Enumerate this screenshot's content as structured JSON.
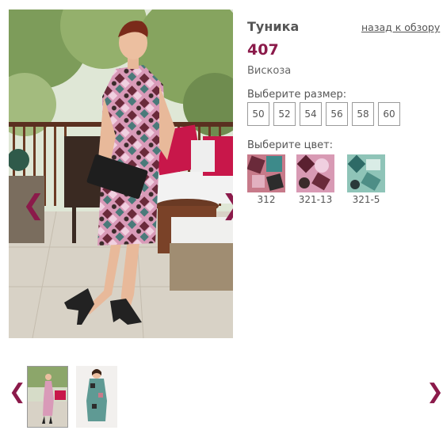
{
  "product": {
    "title": "Туника",
    "article": "407",
    "material": "Вискоза",
    "back_link": "назад к обзору"
  },
  "sizes": {
    "label": "Выберите размер:",
    "options": [
      "50",
      "52",
      "54",
      "56",
      "58",
      "60"
    ]
  },
  "colors": {
    "label": "Выберите цвет:",
    "options": [
      "312",
      "321-13",
      "321-5"
    ]
  },
  "gallery": {
    "prev_arrow": "❮",
    "next_arrow": "❯"
  },
  "thumbnails": {
    "prev_arrow": "❮",
    "next_arrow": "❯"
  },
  "theme": {
    "accent": "#8b1a4a",
    "text": "#555555",
    "border": "#9a9a9a"
  }
}
